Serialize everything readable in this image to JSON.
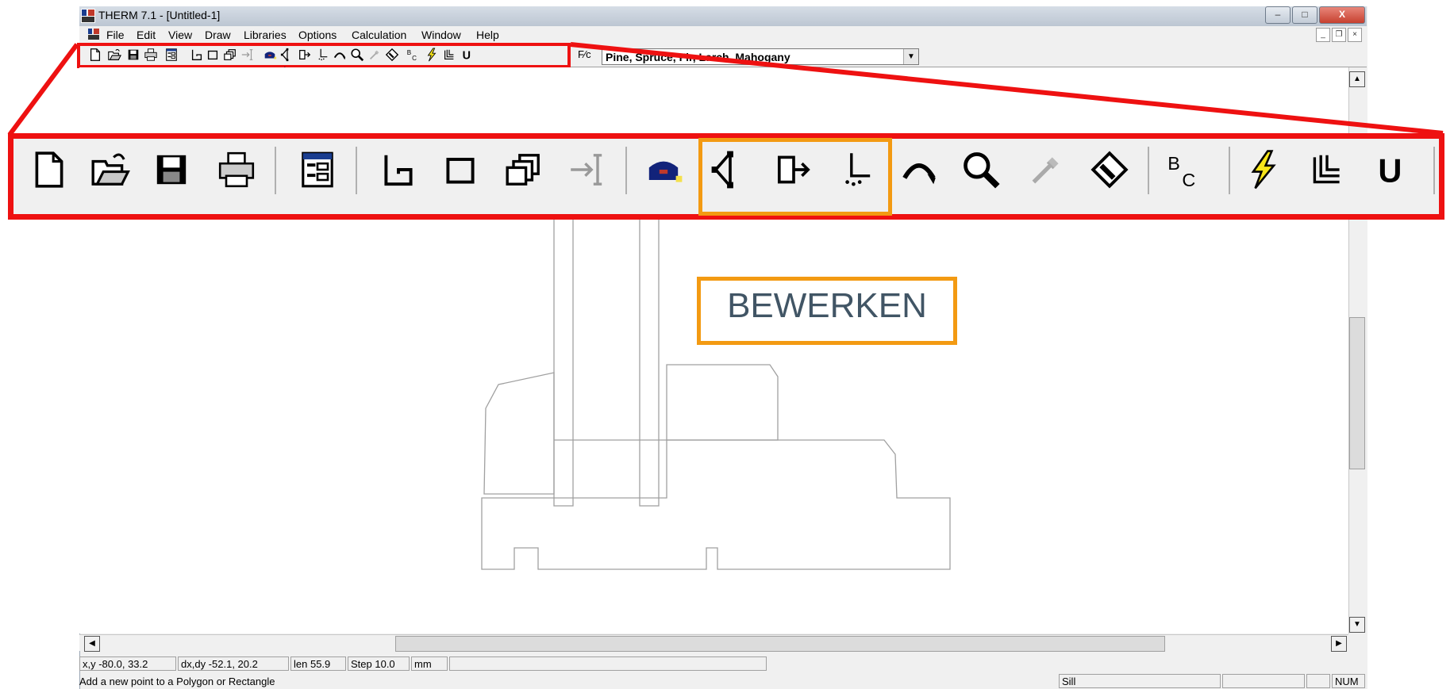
{
  "window": {
    "title": "THERM 7.1 - [Untitled-1]",
    "controls": {
      "minimize": "–",
      "maximize": "□",
      "close": "X"
    },
    "mdi_controls": {
      "minimize": "_",
      "restore": "❐",
      "close": "×"
    }
  },
  "menu": {
    "items": [
      "File",
      "Edit",
      "View",
      "Draw",
      "Libraries",
      "Options",
      "Calculation",
      "Window",
      "Help"
    ]
  },
  "toolbar": {
    "material_select": {
      "value": "Pine, Spruce, Fir, Larch, Mahogany"
    },
    "fraction_label": "F⁄c",
    "icons": [
      "new-file-icon",
      "open-file-icon",
      "save-icon",
      "print-icon",
      "properties-icon",
      "polygon-draw-icon",
      "rectangle-icon",
      "fill-void-icon",
      "dimension-icon",
      "tape-measure-icon",
      "insert-point-icon",
      "move-point-icon",
      "point-snap-icon",
      "arc-icon",
      "zoom-icon",
      "eyedropper-icon",
      "rotate-icon",
      "boundary-condition-icon",
      "calculate-icon",
      "isotherm-icon",
      "u-factor-icon"
    ]
  },
  "zoom_panel": {
    "icons": [
      "new-file-icon",
      "open-file-icon",
      "save-icon",
      "print-icon",
      "properties-icon",
      "polygon-draw-icon",
      "rectangle-icon",
      "fill-void-icon",
      "dimension-icon",
      "tape-measure-icon",
      "insert-point-icon",
      "move-point-icon",
      "point-snap-icon",
      "arc-icon",
      "zoom-icon",
      "eyedropper-icon",
      "rotate-icon",
      "boundary-condition-icon",
      "calculate-icon",
      "isotherm-icon",
      "u-factor-icon"
    ],
    "glyphs": {
      "bc": "BC",
      "u": "U"
    }
  },
  "annotation": {
    "label": "BEWERKEN",
    "colors": {
      "highlight": "#ee1111",
      "group": "#f39a12",
      "label_text": "#415565"
    }
  },
  "status": {
    "xy": "x,y -80.0, 33.2",
    "dxdy": "dx,dy -52.1, 20.2",
    "len": "len  55.9",
    "step": "Step  10.0",
    "units": "mm",
    "hint": "Add a new point to a Polygon or Rectangle",
    "sill": "Sill",
    "num": "NUM"
  }
}
